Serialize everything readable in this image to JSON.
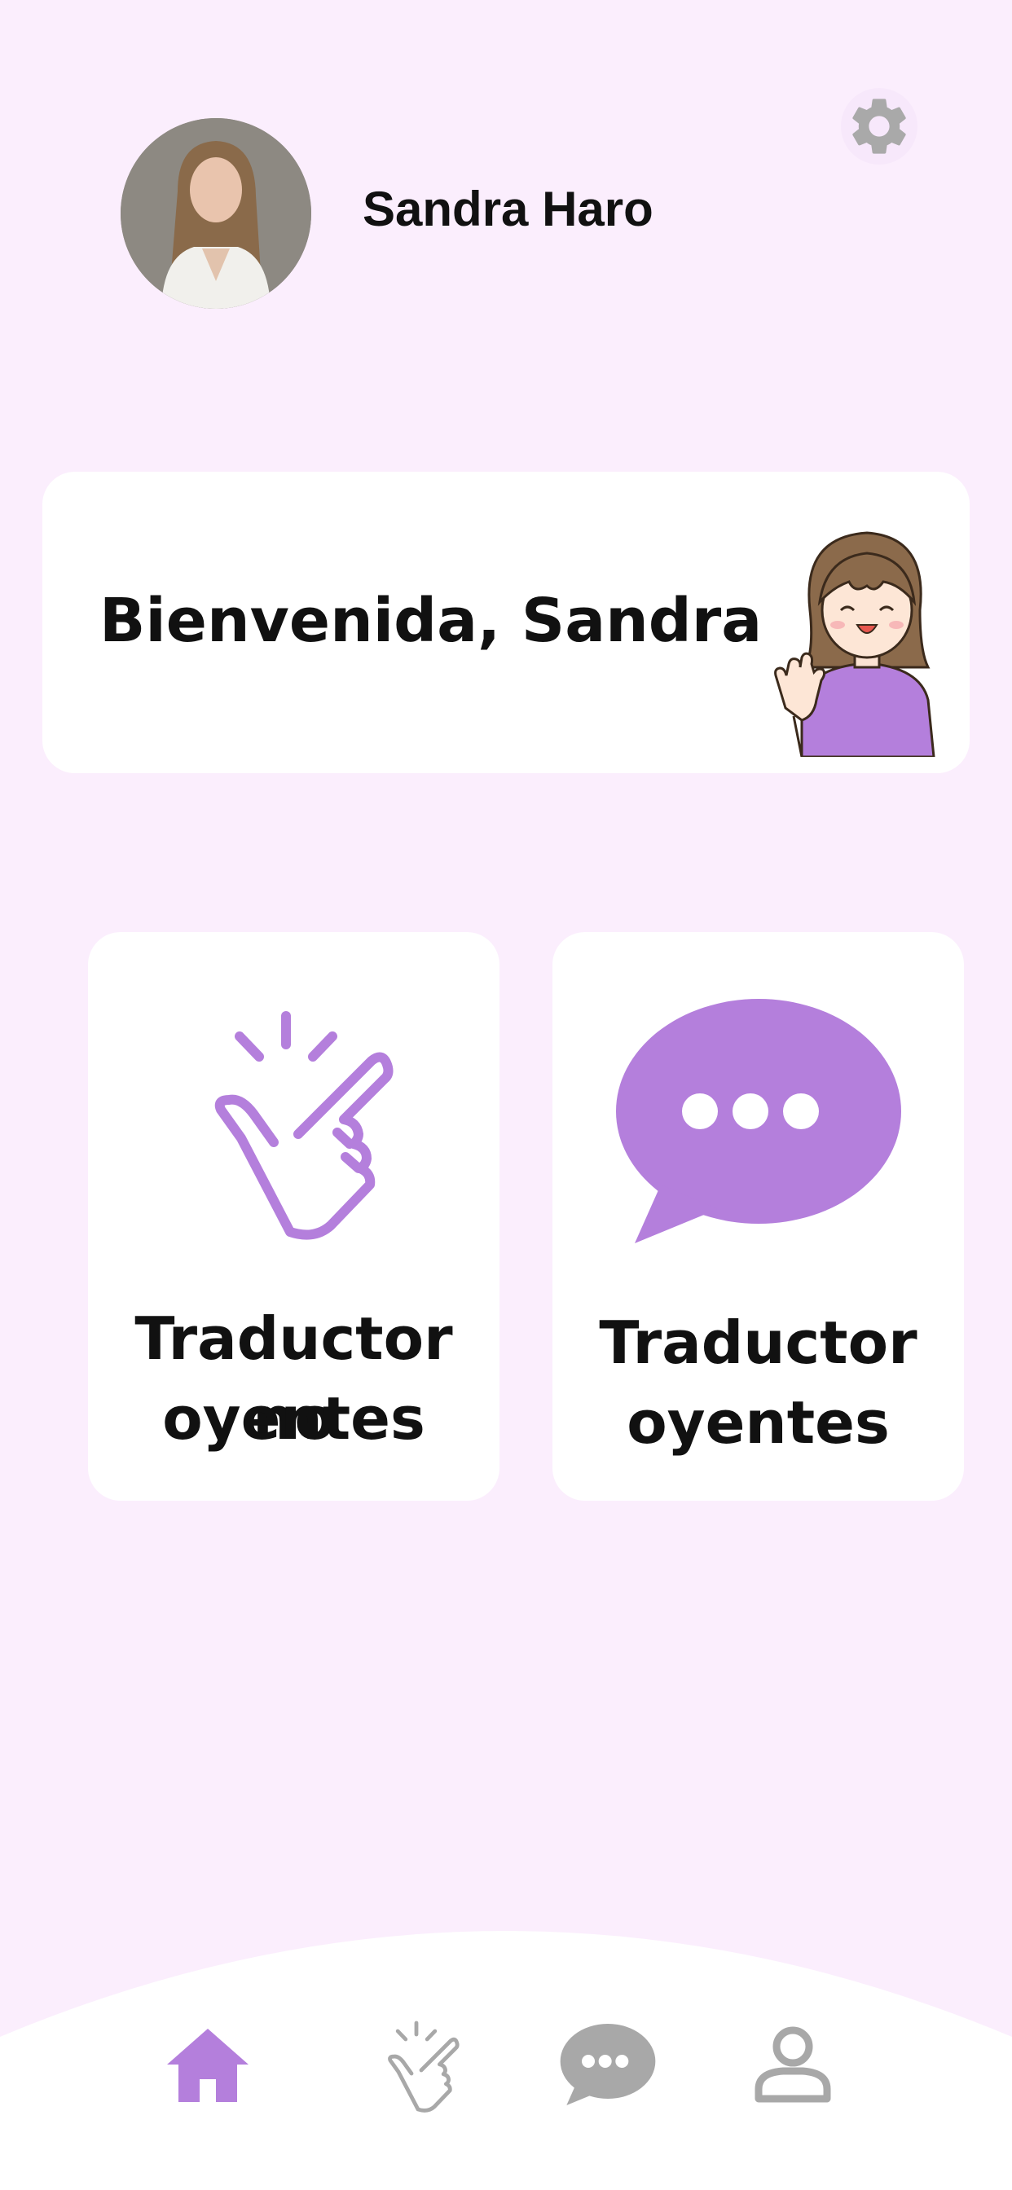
{
  "header": {
    "user_name": "Sandra Haro"
  },
  "welcome": {
    "text": "Bienvenida, Sandra"
  },
  "cards": [
    {
      "label_line1": "Traductor no",
      "label_line2": "oyentes",
      "icon": "hand-gesture-icon"
    },
    {
      "label_line1": "Traductor",
      "label_line2": "oyentes",
      "icon": "chat-bubble-icon"
    }
  ],
  "nav": {
    "items": [
      {
        "icon": "home-icon",
        "active": true
      },
      {
        "icon": "hand-gesture-icon",
        "active": false
      },
      {
        "icon": "chat-bubble-icon",
        "active": false
      },
      {
        "icon": "profile-icon",
        "active": false
      }
    ]
  },
  "colors": {
    "background": "#fbeefd",
    "accent": "#b47fdc",
    "inactive": "#a8a8a8",
    "card": "#ffffff"
  }
}
